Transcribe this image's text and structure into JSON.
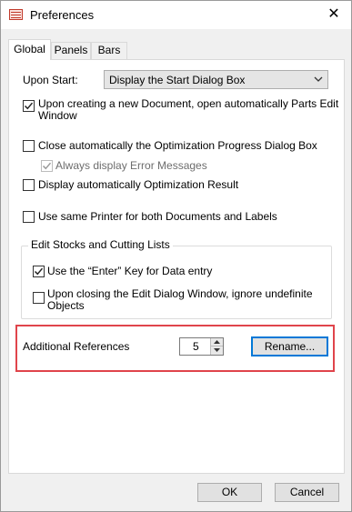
{
  "window": {
    "title": "Preferences",
    "close_glyph": "✕",
    "icon": "app-icon"
  },
  "tabs": [
    {
      "label": "Global",
      "active": true
    },
    {
      "label": "Panels",
      "active": false
    },
    {
      "label": "Bars",
      "active": false
    }
  ],
  "global": {
    "upon_start_label": "Upon Start:",
    "upon_start_value": "Display the Start Dialog Box",
    "open_parts_edit": {
      "label_line1": "Upon creating a new Document, open automatically Parts Edit",
      "label_line2": "Window",
      "checked": true
    },
    "close_optimization": {
      "label": "Close automatically the Optimization Progress Dialog Box",
      "checked": false
    },
    "always_display_errors": {
      "label": "Always display Error Messages",
      "checked": true,
      "disabled": true
    },
    "display_optimization_result": {
      "label": "Display automatically Optimization Result",
      "checked": false
    },
    "same_printer": {
      "label": "Use same Printer for both Documents and Labels",
      "checked": false
    },
    "edit_stocks_group": {
      "title": "Edit Stocks and Cutting Lists",
      "enter_key": {
        "label": "Use the “Enter” Key for Data entry",
        "checked": true
      },
      "ignore_undefinite": {
        "label_line1": "Upon closing the Edit Dialog Window, ignore undefinite",
        "label_line2": "Objects",
        "checked": false
      }
    },
    "additional_references": {
      "label": "Additional References",
      "value": "5",
      "rename_label": "Rename..."
    }
  },
  "footer": {
    "ok_label": "OK",
    "cancel_label": "Cancel"
  },
  "colors": {
    "highlight": "#e0444b",
    "default_button_border": "#0078d7"
  }
}
